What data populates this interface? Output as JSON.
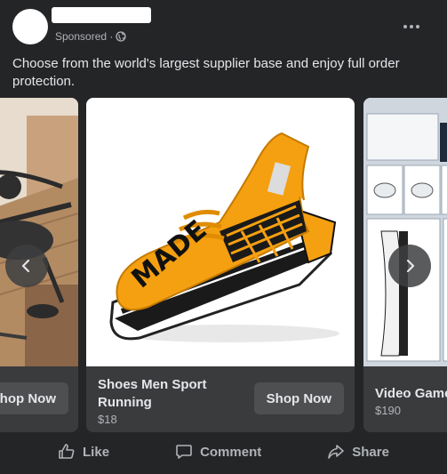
{
  "post": {
    "sponsored_label": "Sponsored ·",
    "more_icon": "more-horizontal-icon",
    "caption": "Choose from the world's largest supplier base and enjoy full order protection."
  },
  "carousel": {
    "cards": [
      {
        "title": "",
        "price": "",
        "shop_label": "Shop Now"
      },
      {
        "title": "Shoes Men Sport Running",
        "price": "$18",
        "shop_label": "Shop Now"
      },
      {
        "title": "Video Game",
        "price": "$190",
        "shop_label": ""
      }
    ],
    "prev_icon": "chevron-left-icon",
    "next_icon": "chevron-right-icon",
    "shoe_text": "MADE"
  },
  "actions": {
    "like": "Like",
    "comment": "Comment",
    "share": "Share"
  },
  "colors": {
    "background": "#242526",
    "card": "#3a3b3c",
    "shoe": "#f5a011"
  }
}
